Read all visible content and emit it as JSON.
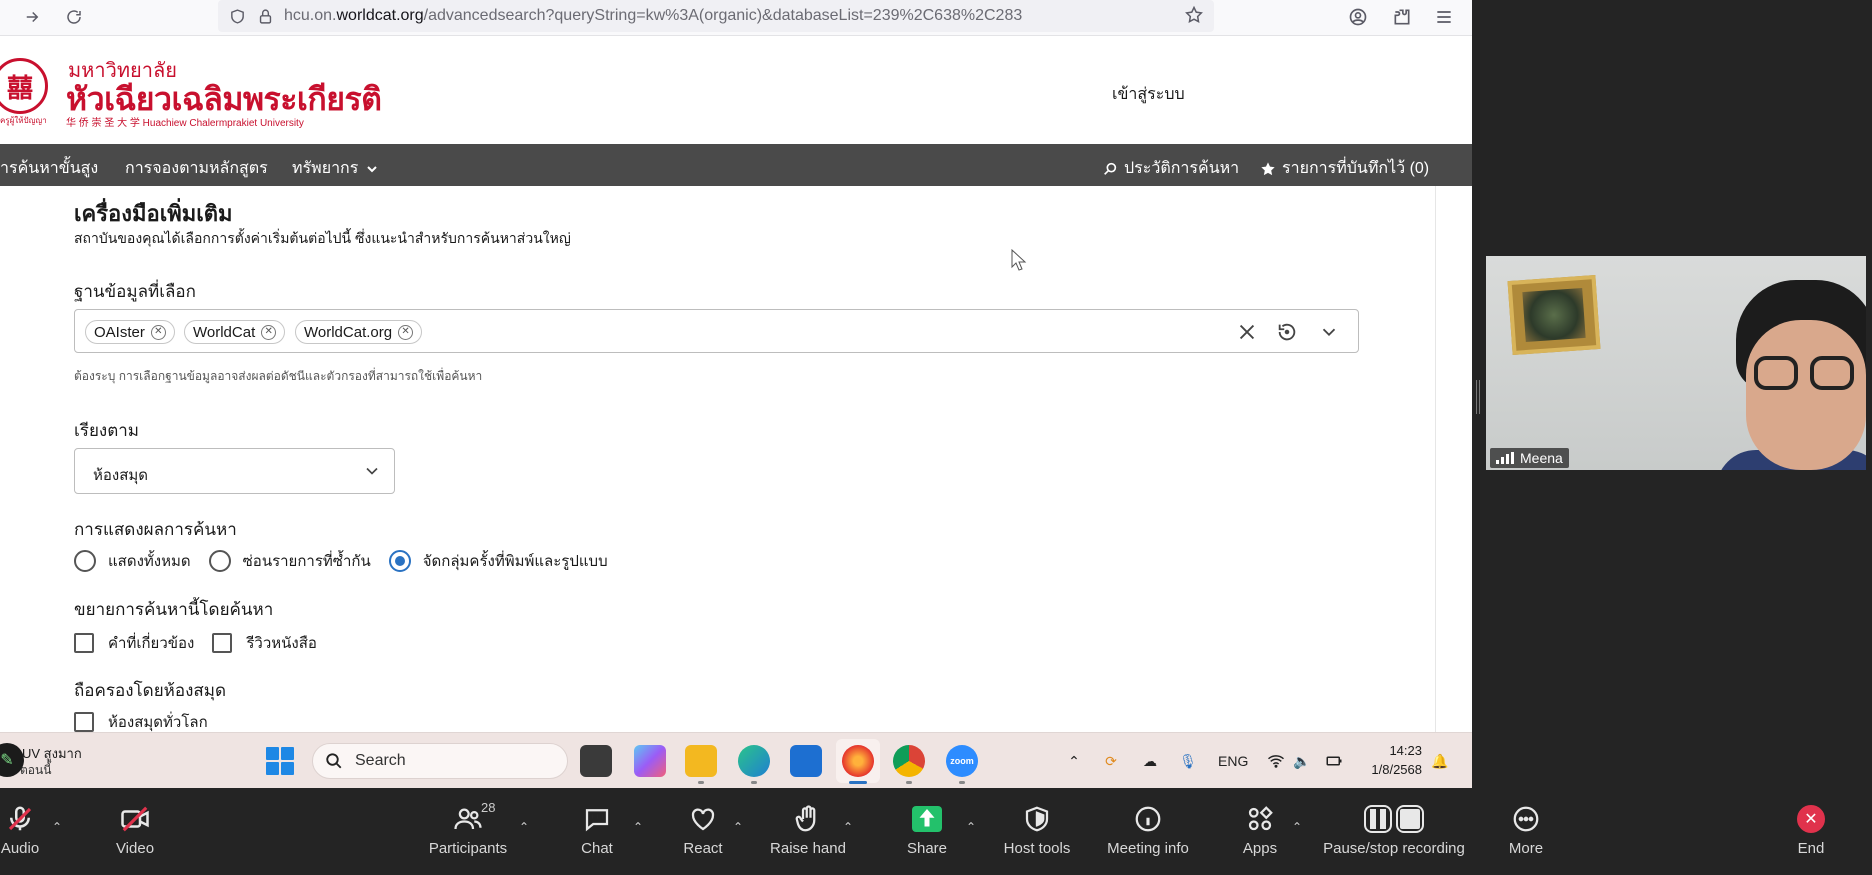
{
  "browser": {
    "url_prefix": "hcu.on.",
    "url_host": "worldcat.org",
    "url_rest": "/advancedsearch?queryString=kw%3A(organic)&databaseList=239%2C638%2C283"
  },
  "site": {
    "logo_line1": "มหาวิทยาลัย",
    "logo_line2": "หัวเฉียวเฉลิมพระเกียรติ",
    "logo_line3": "华 侨 崇 圣 大 学   Huachiew Chalermprakiet University",
    "logo_tagline": "ครูผู้ให้ปัญญา",
    "login": "เข้าสู่ระบบ"
  },
  "nav": {
    "items": [
      "ารค้นหาขั้นสูง",
      "การจองตามหลักสูตร",
      "ทรัพยากร"
    ],
    "history": "ประวัติการค้นหา",
    "saved": "รายการที่บันทึกไว้ (0)"
  },
  "form": {
    "section_title": "เครื่องมือเพิ่มเติม",
    "section_desc": "สถาบันของคุณได้เลือกการตั้งค่าเริ่มต้นต่อไปนี้ ซึ่งแนะนำสำหรับการค้นหาส่วนใหญ่",
    "db_label": "ฐานข้อมูลที่เลือก",
    "db_chips": [
      "OAIster",
      "WorldCat",
      "WorldCat.org"
    ],
    "db_helper": "ต้องระบุ การเลือกฐานข้อมูลอาจส่งผลต่อดัชนีและตัวกรองที่สามารถใช้เพื่อค้นหา",
    "sort_label": "เรียงตาม",
    "sort_value": "ห้องสมุด",
    "display_label": "การแสดงผลการค้นหา",
    "display_options": [
      "แสดงทั้งหมด",
      "ซ่อนรายการที่ซ้ำกัน",
      "จัดกลุ่มครั้งที่พิมพ์และรูปแบบ"
    ],
    "display_selected": 2,
    "expand_label": "ขยายการค้นหานี้โดยค้นหา",
    "expand_options": [
      "คำที่เกี่ยวข้อง",
      "รีวิวหนังสือ"
    ],
    "held_label": "ถือครองโดยห้องสมุด",
    "held_options": [
      "ห้องสมุดทั่วโลก"
    ]
  },
  "taskbar": {
    "notif_title": "UV สูงมาก",
    "notif_sub": "ตอนนี้",
    "search": "Search",
    "lang": "ENG",
    "time": "14:23",
    "date": "1/8/2568",
    "zoom_app_label": "zoom"
  },
  "video": {
    "participant_name": "Meena"
  },
  "zoom": {
    "audio": "Audio",
    "video": "Video",
    "participants": "Participants",
    "participants_count": "28",
    "chat": "Chat",
    "react": "React",
    "raise_hand": "Raise hand",
    "share": "Share",
    "host_tools": "Host tools",
    "meeting_info": "Meeting info",
    "apps": "Apps",
    "pause_record": "Pause/stop recording",
    "more": "More",
    "end": "End"
  },
  "colors": {
    "brand_red": "#c8102e",
    "nav_gray": "#4a4a4a",
    "radio_blue": "#2a72c2",
    "share_green": "#23c16b",
    "end_red": "#e0324c"
  }
}
